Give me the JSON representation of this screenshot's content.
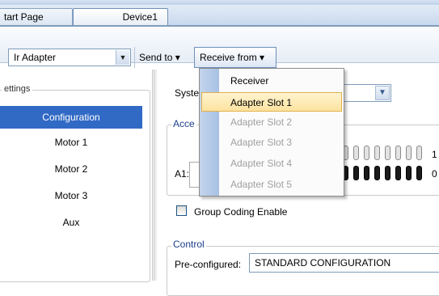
{
  "tabs": [
    {
      "label": "tart Page"
    },
    {
      "label": "Device1"
    }
  ],
  "toolbar": {
    "adapter_value": "Ir Adapter",
    "send_to": "Send to",
    "receive_from": "Receive from",
    "arrow": "▾"
  },
  "left_panel": {
    "group_label": "ettings",
    "items": [
      {
        "label": "Configuration",
        "selected": true
      },
      {
        "label": "Motor 1"
      },
      {
        "label": "Motor 2"
      },
      {
        "label": "Motor 3"
      },
      {
        "label": "Aux"
      }
    ]
  },
  "main": {
    "system_label": "Syste",
    "access_label": "Acce",
    "a1_label": "A1:",
    "bit_row_1_label": "1",
    "bit_row_0_label": "0",
    "group_coding_label": "Group Coding Enable",
    "control_label": "Control",
    "preconfigured_label": "Pre-configured:",
    "preconfigured_value": "STANDARD CONFIGURATION"
  },
  "receive_menu": {
    "items": [
      {
        "label": "Receiver",
        "enabled": true
      },
      {
        "label": "Adapter Slot 1",
        "enabled": true,
        "highlighted": true
      },
      {
        "label": "Adapter Slot 2",
        "enabled": false
      },
      {
        "label": "Adapter Slot 3",
        "enabled": false
      },
      {
        "label": "Adapter Slot 4",
        "enabled": false
      },
      {
        "label": "Adapter Slot 5",
        "enabled": false
      }
    ]
  },
  "colors": {
    "selection_blue": "#316ac5",
    "menu_highlight": "#fde3a0",
    "disabled_text": "#a0a0a0"
  }
}
